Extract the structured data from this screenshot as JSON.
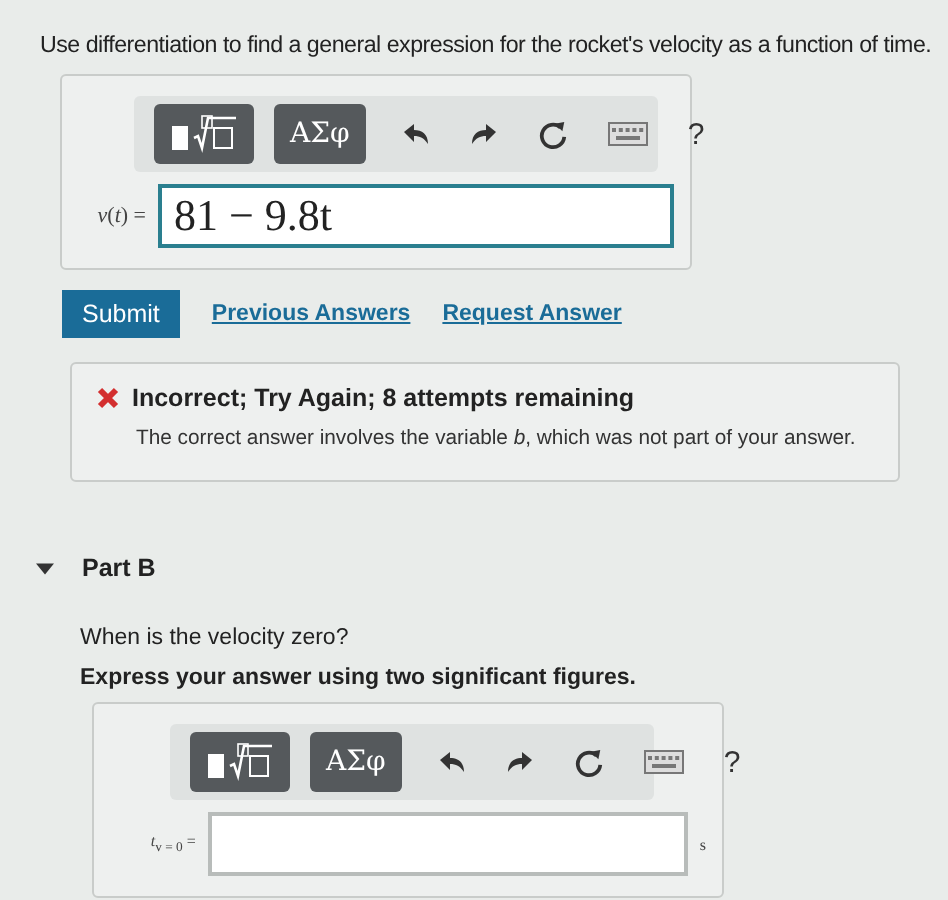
{
  "question": "Use differentiation to find a general expression for the rocket's velocity as a function of time.",
  "part_a": {
    "toolbar": {
      "symbols_label": "ΑΣφ",
      "help_label": "?"
    },
    "answer": {
      "label": "*v*(*t*) =",
      "value": "81 − 9.8t"
    }
  },
  "actions": {
    "submit": "Submit",
    "links": [
      "Previous Answers",
      "Request Answer"
    ]
  },
  "feedback": {
    "title": "Incorrect; Try Again; 8 attempts remaining",
    "message": "The correct answer involves the variable *b*, which was not part of your answer."
  },
  "part_b": {
    "title": "Part B",
    "expanded": true,
    "question": "When is the velocity zero?",
    "instruction": "Express your answer using two significant figures.",
    "toolbar": {
      "symbols_label": "ΑΣφ",
      "help_label": "?"
    },
    "answer": {
      "label": "*t*$_{v = 0}$ =",
      "unit": "s"
    }
  }
}
